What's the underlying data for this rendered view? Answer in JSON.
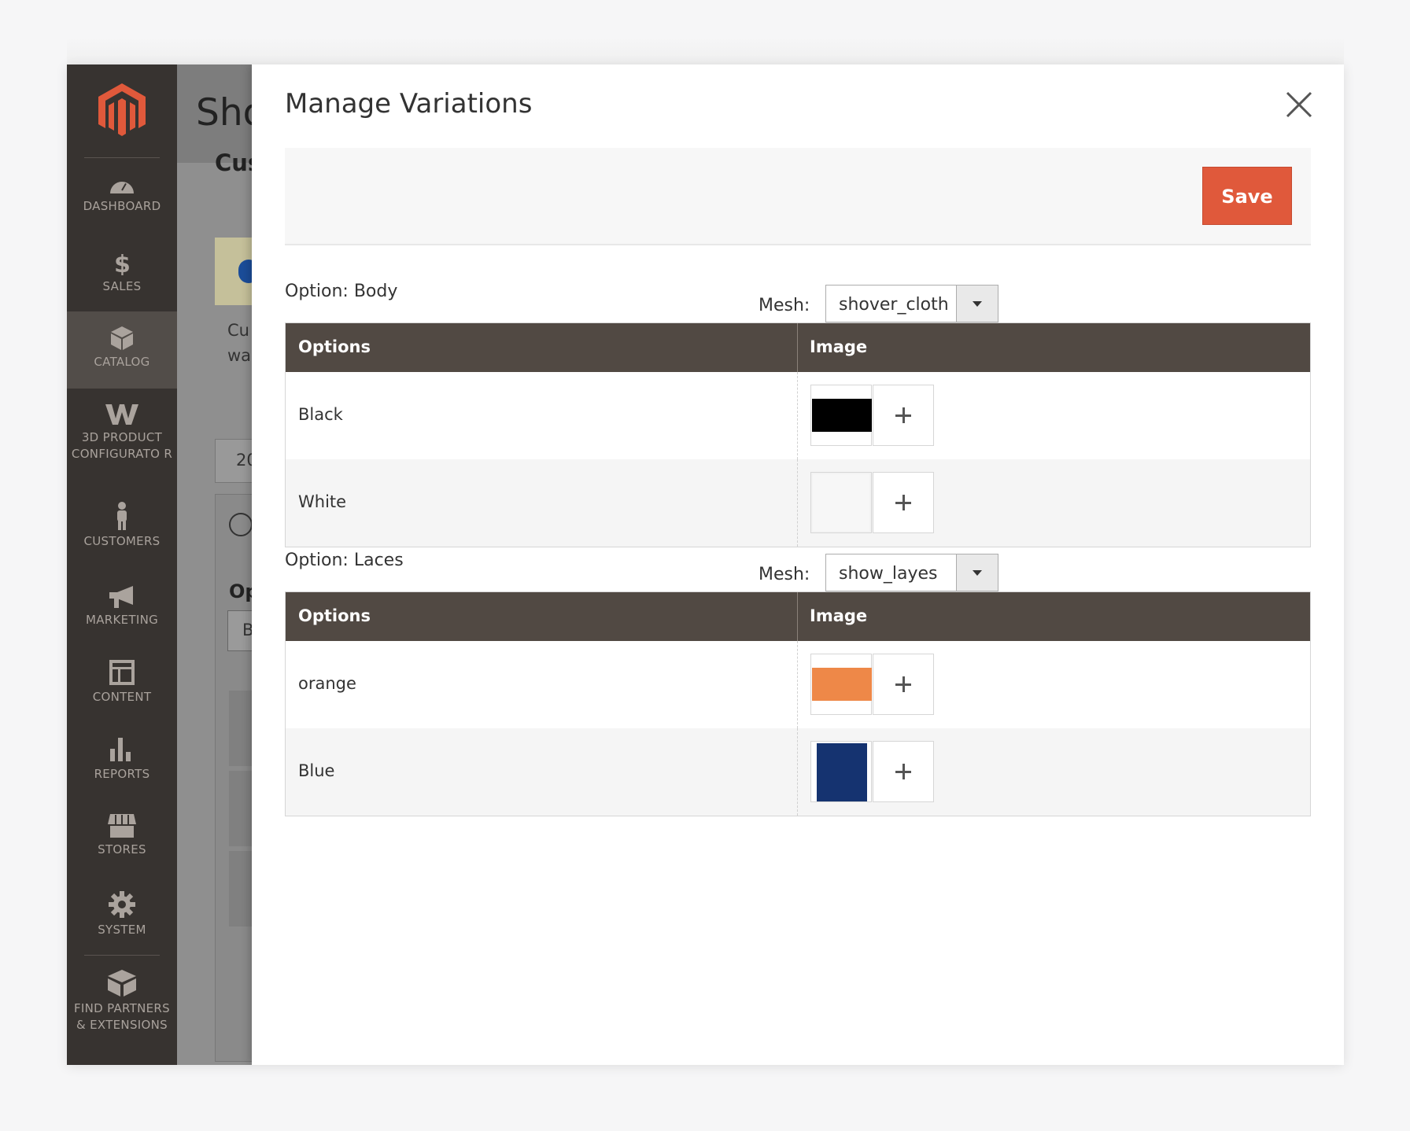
{
  "sidebar": {
    "items": [
      {
        "label": "DASHBOARD",
        "icon": "dashboard-icon"
      },
      {
        "label": "SALES",
        "icon": "dollar-icon"
      },
      {
        "label": "CATALOG",
        "icon": "box-icon"
      },
      {
        "label": "3D PRODUCT CONFIGURATO R",
        "icon": "configurator-w-icon"
      },
      {
        "label": "CUSTOMERS",
        "icon": "person-icon"
      },
      {
        "label": "MARKETING",
        "icon": "megaphone-icon"
      },
      {
        "label": "CONTENT",
        "icon": "layout-icon"
      },
      {
        "label": "REPORTS",
        "icon": "bar-chart-icon"
      },
      {
        "label": "STORES",
        "icon": "store-icon"
      },
      {
        "label": "SYSTEM",
        "icon": "gear-icon"
      },
      {
        "label": "FIND PARTNERS & EXTENSIONS",
        "icon": "cube-icon"
      }
    ]
  },
  "background_page": {
    "title": "Sho",
    "subtitle": "Cus",
    "text_line1": "Cu",
    "text_line2": "wa",
    "field_value": "20",
    "section_label": "Op",
    "select_value": "B"
  },
  "modal": {
    "title": "Manage Variations",
    "save_label": "Save",
    "options": [
      {
        "label": "Option: Body",
        "mesh_label": "Mesh:",
        "mesh_value": "shover_cloth",
        "col_options": "Options",
        "col_image": "Image",
        "rows": [
          {
            "name": "Black",
            "color": "#000000"
          },
          {
            "name": "White",
            "color": "#f7f7f7"
          }
        ]
      },
      {
        "label": "Option: Laces",
        "mesh_label": "Mesh:",
        "mesh_value": "show_layes",
        "col_options": "Options",
        "col_image": "Image",
        "rows": [
          {
            "name": "orange",
            "color": "#ee8848"
          },
          {
            "name": "Blue",
            "color": "#153370"
          }
        ]
      }
    ]
  },
  "colors": {
    "accent": "#e0593b",
    "sidebar": "#373330",
    "table_header": "#514943"
  }
}
